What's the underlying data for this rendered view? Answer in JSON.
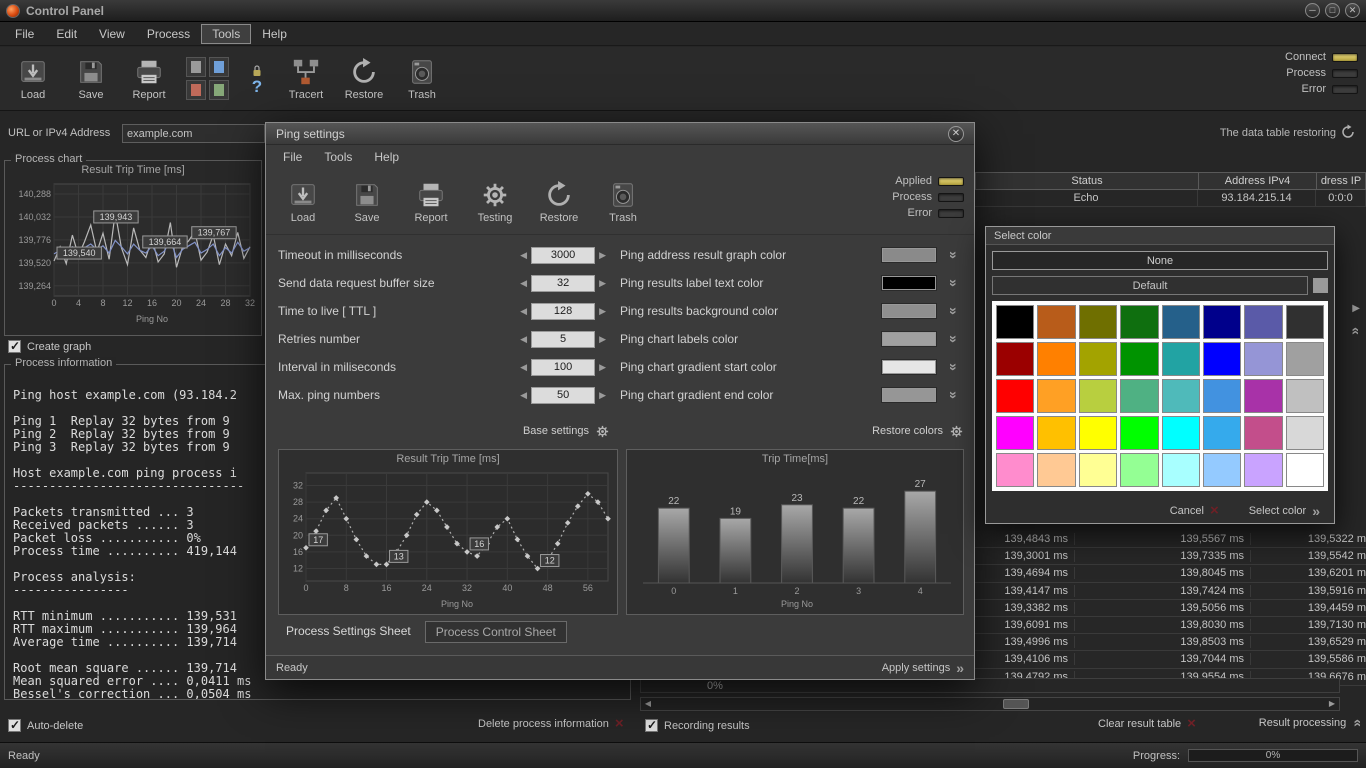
{
  "titlebar": {
    "title": "Control Panel"
  },
  "menubar": {
    "items": [
      "File",
      "Edit",
      "View",
      "Process",
      "Tools",
      "Help"
    ],
    "active": "Tools"
  },
  "toolbar": {
    "load": "Load",
    "save": "Save",
    "report": "Report",
    "tracert": "Tracert",
    "restore": "Restore",
    "trash": "Trash",
    "leds": [
      {
        "label": "Connect",
        "on": true
      },
      {
        "label": "Process",
        "on": false
      },
      {
        "label": "Error",
        "on": false
      }
    ]
  },
  "urlbar": {
    "label": "URL or IPv4 Address",
    "value": "example.com",
    "restore_text": "The data table restoring"
  },
  "left": {
    "chart_group": "Process chart",
    "create_graph": "Create graph",
    "info_title": "Process information",
    "info_lines": [
      "Ping host example.com (93.184.2",
      "",
      "Ping 1  Replay 32 bytes from 9",
      "Ping 2  Replay 32 bytes from 9",
      "Ping 3  Replay 32 bytes from 9",
      "",
      "Host example.com ping process i",
      "--------------------------------",
      "",
      "Packets transmitted ... 3",
      "Received packets ...... 3",
      "Packet loss ........... 0%",
      "Process time .......... 419,144",
      "",
      "Process analysis:",
      "----------------",
      "",
      "RTT minimum ........... 139,531",
      "RTT maximum ........... 139,964",
      "Average time .......... 139,714",
      "",
      "Root mean square ...... 139,714",
      "Mean squared error .... 0,0411 ms",
      "Bessel's correction ... 0,0504 ms"
    ],
    "auto_delete": "Auto-delete",
    "delete_info": "Delete process information"
  },
  "right": {
    "table_headers": [
      "Status",
      "Address IPv4",
      "dress IP"
    ],
    "table_row": [
      "Echo",
      "93.184.215.14",
      "0:0:0"
    ],
    "partial_progress": "0%",
    "ms_rows": [
      [
        "139,4843 ms",
        "139,5567 ms",
        "139,5322 m"
      ],
      [
        "139,3001 ms",
        "139,7335 ms",
        "139,5542 m"
      ],
      [
        "139,4694 ms",
        "139,8045 ms",
        "139,6201 m"
      ],
      [
        "139,4147 ms",
        "139,7424 ms",
        "139,5916 m"
      ],
      [
        "139,3382 ms",
        "139,5056 ms",
        "139,4459 m"
      ],
      [
        "139,6091 ms",
        "139,8030 ms",
        "139,7130 m"
      ],
      [
        "139,4996 ms",
        "139,8503 ms",
        "139,6529 m"
      ],
      [
        "139,4106 ms",
        "139,7044 ms",
        "139,5586 m"
      ],
      [
        "139,4792 ms",
        "139,9554 ms",
        "139,6676 m"
      ]
    ],
    "recording": "Recording results",
    "clear_table": "Clear result table",
    "result_processing": "Result processing"
  },
  "statusbar": {
    "ready": "Ready",
    "progress_label": "Progress:",
    "progress_value": "0%"
  },
  "dialog": {
    "title": "Ping settings",
    "menu": [
      "File",
      "Tools",
      "Help"
    ],
    "tb": {
      "load": "Load",
      "save": "Save",
      "report": "Report",
      "testing": "Testing",
      "restore": "Restore",
      "trash": "Trash"
    },
    "leds": [
      {
        "label": "Applied",
        "on": true
      },
      {
        "label": "Process",
        "on": false
      },
      {
        "label": "Error",
        "on": false
      }
    ],
    "settings": [
      {
        "label": "Timeout in milliseconds",
        "value": "3000"
      },
      {
        "label": "Send data request buffer size",
        "value": "32"
      },
      {
        "label": "Time to live [ TTL ]",
        "value": "128"
      },
      {
        "label": "Retries number",
        "value": "5"
      },
      {
        "label": "Interval in miliseconds",
        "value": "100"
      },
      {
        "label": "Max. ping numbers",
        "value": "50"
      }
    ],
    "colors": [
      {
        "label": "Ping address result graph color",
        "swatch": "#8a8a8a"
      },
      {
        "label": "Ping results label text color",
        "swatch": "#000000"
      },
      {
        "label": "Ping results background color",
        "swatch": "#8f8f8f"
      },
      {
        "label": "Ping chart labels color",
        "swatch": "#a0a0a0"
      },
      {
        "label": "Ping chart gradient start color",
        "swatch": "#e6e6e6"
      },
      {
        "label": "Ping chart gradient end color",
        "swatch": "#969696"
      }
    ],
    "base_settings": "Base settings",
    "restore_colors": "Restore colors",
    "tabs": [
      "Process Settings Sheet",
      "Process Control Sheet"
    ],
    "active_tab": "Process Settings Sheet",
    "status_ready": "Ready",
    "apply": "Apply settings"
  },
  "color_picker": {
    "title": "Select color",
    "none": "None",
    "default": "Default",
    "default_swatch": "#9a9a9a",
    "cancel": "Cancel",
    "select": "Select color",
    "palette": [
      "#000000",
      "#b85c1a",
      "#6f6f00",
      "#0f6f0f",
      "#25608a",
      "#00008b",
      "#5a5aa8",
      "#303030",
      "#9b0000",
      "#ff8000",
      "#a3a300",
      "#009300",
      "#22a3a3",
      "#0000ff",
      "#9595d6",
      "#a0a0a0",
      "#ff0000",
      "#ffa024",
      "#b8cf3f",
      "#4fb183",
      "#4fbaba",
      "#4292e0",
      "#a832a8",
      "#c0c0c0",
      "#ff00ff",
      "#ffc000",
      "#ffff00",
      "#00ff00",
      "#00ffff",
      "#35aaec",
      "#c34e8b",
      "#d8d8d8",
      "#ff8ccd",
      "#ffc994",
      "#ffff94",
      "#94ff94",
      "#a8ffff",
      "#94caff",
      "#c9a3ff",
      "#ffffff"
    ]
  },
  "chart_data": [
    {
      "name": "process-trip",
      "type": "line",
      "title": "Result Trip Time [ms]",
      "xlabel": "Ping No",
      "x_ticks": [
        0,
        4,
        8,
        12,
        16,
        20,
        24,
        28,
        32
      ],
      "y_ticks": [
        139264,
        139520,
        139776,
        140032,
        140288
      ],
      "y_tick_labels": [
        "139,264",
        "139,520",
        "139,776",
        "140,032",
        "140,288"
      ],
      "xlim": [
        0,
        32
      ],
      "ylim": [
        139150,
        140400
      ],
      "x_step": 1,
      "series": [
        {
          "name": "trip-time",
          "color": "#b9b9b9",
          "values": [
            139540,
            139700,
            139510,
            139830,
            139600,
            139760,
            139943,
            139640,
            139850,
            139560,
            140080,
            139690,
            139500,
            139910,
            139664,
            139580,
            139790,
            139530,
            139620,
            139970,
            139470,
            139700,
            139767,
            139870,
            139550,
            139640,
            139830,
            139500,
            139730,
            139600,
            139860,
            139570,
            139700
          ]
        },
        {
          "name": "average",
          "color": "#8292c8",
          "values": [
            139620,
            139660,
            139630,
            139700,
            139650,
            139690,
            139730,
            139670,
            139710,
            139630,
            139770,
            139700,
            139620,
            139730,
            139660,
            139630,
            139710,
            139600,
            139650,
            139770,
            139580,
            139670,
            139710,
            139750,
            139630,
            139670,
            139730,
            139600,
            139690,
            139630,
            139750,
            139650,
            139690
          ]
        }
      ],
      "annotations": [
        {
          "x": 0,
          "y": 139540,
          "label": "139,540"
        },
        {
          "x": 6,
          "y": 139943,
          "label": "139,943"
        },
        {
          "x": 14,
          "y": 139664,
          "label": "139,664"
        },
        {
          "x": 22,
          "y": 139767,
          "label": "139,767"
        }
      ]
    },
    {
      "name": "dialog-trip",
      "type": "line",
      "title": "Result Trip Time [ms]",
      "xlabel": "Ping No",
      "x_ticks": [
        0,
        8,
        16,
        24,
        32,
        40,
        48,
        56
      ],
      "y_ticks": [
        12,
        16,
        20,
        24,
        28,
        32
      ],
      "xlim": [
        0,
        60
      ],
      "ylim": [
        9,
        35
      ],
      "x_step": 2,
      "series": [
        {
          "name": "trip-time",
          "color": "#b0b0b0",
          "dash": "2 3",
          "markers": true,
          "values": [
            17,
            21,
            26,
            29,
            24,
            19,
            15,
            13,
            13,
            16,
            20,
            25,
            28,
            26,
            22,
            18,
            16,
            15,
            18,
            22,
            24,
            19,
            15,
            12,
            14,
            18,
            23,
            27,
            30,
            28,
            24
          ]
        }
      ],
      "annotations": [
        {
          "x": 0,
          "y": 17,
          "label": "17"
        },
        {
          "x": 16,
          "y": 13,
          "label": "13"
        },
        {
          "x": 32,
          "y": 16,
          "label": "16"
        },
        {
          "x": 46,
          "y": 12,
          "label": "12"
        }
      ]
    },
    {
      "name": "dialog-bars",
      "type": "bar",
      "title": "Trip Time[ms]",
      "xlabel": "Ping No",
      "categories": [
        "0",
        "1",
        "2",
        "3",
        "4"
      ],
      "values": [
        22,
        19,
        23,
        22,
        27
      ],
      "ylim": [
        0,
        30
      ]
    }
  ]
}
